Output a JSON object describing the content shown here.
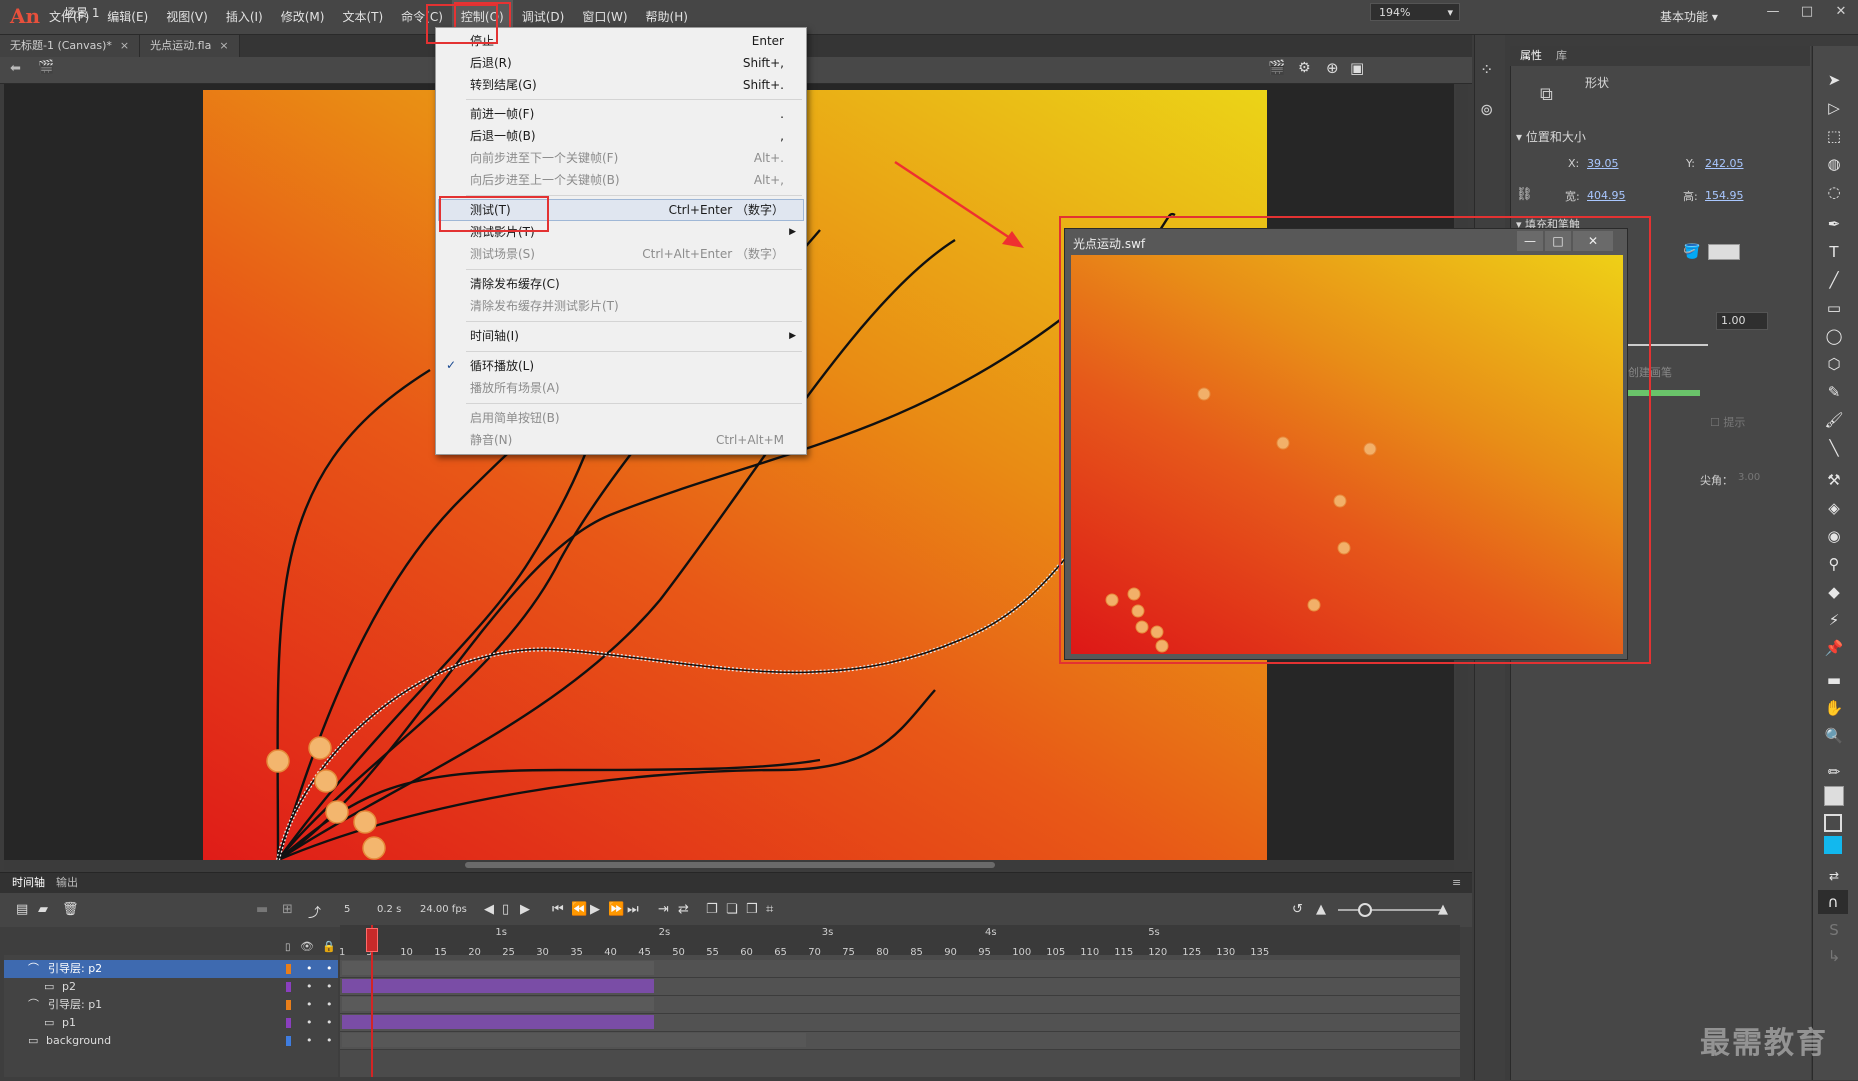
{
  "app": {
    "logo": "An"
  },
  "menubar": {
    "items": [
      "文件(F)",
      "编辑(E)",
      "视图(V)",
      "插入(I)",
      "修改(M)",
      "文本(T)",
      "命令(C)",
      "控制(O)",
      "调试(D)",
      "窗口(W)",
      "帮助(H)"
    ],
    "workspace": "基本功能"
  },
  "tabs": [
    {
      "label": "无标题-1 (Canvas)*"
    },
    {
      "label": "光点运动.fla"
    }
  ],
  "scene": {
    "label": "场景 1",
    "zoom": "194%"
  },
  "control_menu": {
    "items": [
      {
        "label": "停止",
        "shortcut": "Enter"
      },
      {
        "label": "后退(R)",
        "shortcut": "Shift+,"
      },
      {
        "label": "转到结尾(G)",
        "shortcut": "Shift+."
      },
      {
        "label": "前进一帧(F)",
        "shortcut": "."
      },
      {
        "label": "后退一帧(B)",
        "shortcut": ","
      },
      {
        "label": "向前步进至下一个关键帧(F)",
        "shortcut": "Alt+."
      },
      {
        "label": "向后步进至上一个关键帧(B)",
        "shortcut": "Alt+,"
      },
      {
        "label": "测试(T)",
        "shortcut": "Ctrl+Enter （数字）"
      },
      {
        "label": "测试影片(T)",
        "shortcut": ""
      },
      {
        "label": "测试场景(S)",
        "shortcut": "Ctrl+Alt+Enter （数字）"
      },
      {
        "label": "清除发布缓存(C)",
        "shortcut": ""
      },
      {
        "label": "清除发布缓存并测试影片(T)",
        "shortcut": ""
      },
      {
        "label": "时间轴(I)",
        "shortcut": ""
      },
      {
        "label": "循环播放(L)",
        "shortcut": ""
      },
      {
        "label": "播放所有场景(A)",
        "shortcut": ""
      },
      {
        "label": "启用简单按钮(B)",
        "shortcut": ""
      },
      {
        "label": "静音(N)",
        "shortcut": "Ctrl+Alt+M"
      }
    ]
  },
  "swf_window": {
    "title": "光点运动.swf"
  },
  "properties": {
    "tabs": [
      "属性",
      "库"
    ],
    "shape_label": "形状",
    "position_section": "位置和大小",
    "x_label": "X:",
    "x": "39.05",
    "y_label": "Y:",
    "y": "242.05",
    "w_label": "宽:",
    "w": "404.95",
    "h_label": "高:",
    "h": "154.95",
    "fill_section": "填充和笔触",
    "stroke_value": "1.00",
    "style_label": "创建画笔",
    "hint_label": "提示",
    "miter_label": "尖角：",
    "miter_value": "3.00"
  },
  "timeline": {
    "tabs": [
      "时间轴",
      "输出"
    ],
    "current_frame": "5",
    "time": "0.2 s",
    "fps": "24.00 fps",
    "frame_numbers": [
      "1",
      "5",
      "10",
      "15",
      "20",
      "25",
      "30",
      "35",
      "40",
      "45",
      "50",
      "55",
      "60",
      "65",
      "70",
      "75",
      "80",
      "85",
      "90",
      "95",
      "100",
      "105",
      "110",
      "115",
      "120",
      "125",
      "130",
      "135"
    ],
    "seconds": [
      "1s",
      "2s",
      "3s",
      "4s",
      "5s"
    ],
    "layers": [
      {
        "name": "引导层: p2",
        "color": "#e87e1a"
      },
      {
        "name": "p2",
        "color": "#8b3fbf"
      },
      {
        "name": "引导层: p1",
        "color": "#e87e1a"
      },
      {
        "name": "p1",
        "color": "#8b3fbf"
      },
      {
        "name": "background",
        "color": "#3f7de0"
      }
    ]
  },
  "watermark": "最需教育",
  "colors": {
    "accent": "#e33232",
    "selected_layer": "#3e6ab0",
    "tween": "#7a4da6"
  }
}
